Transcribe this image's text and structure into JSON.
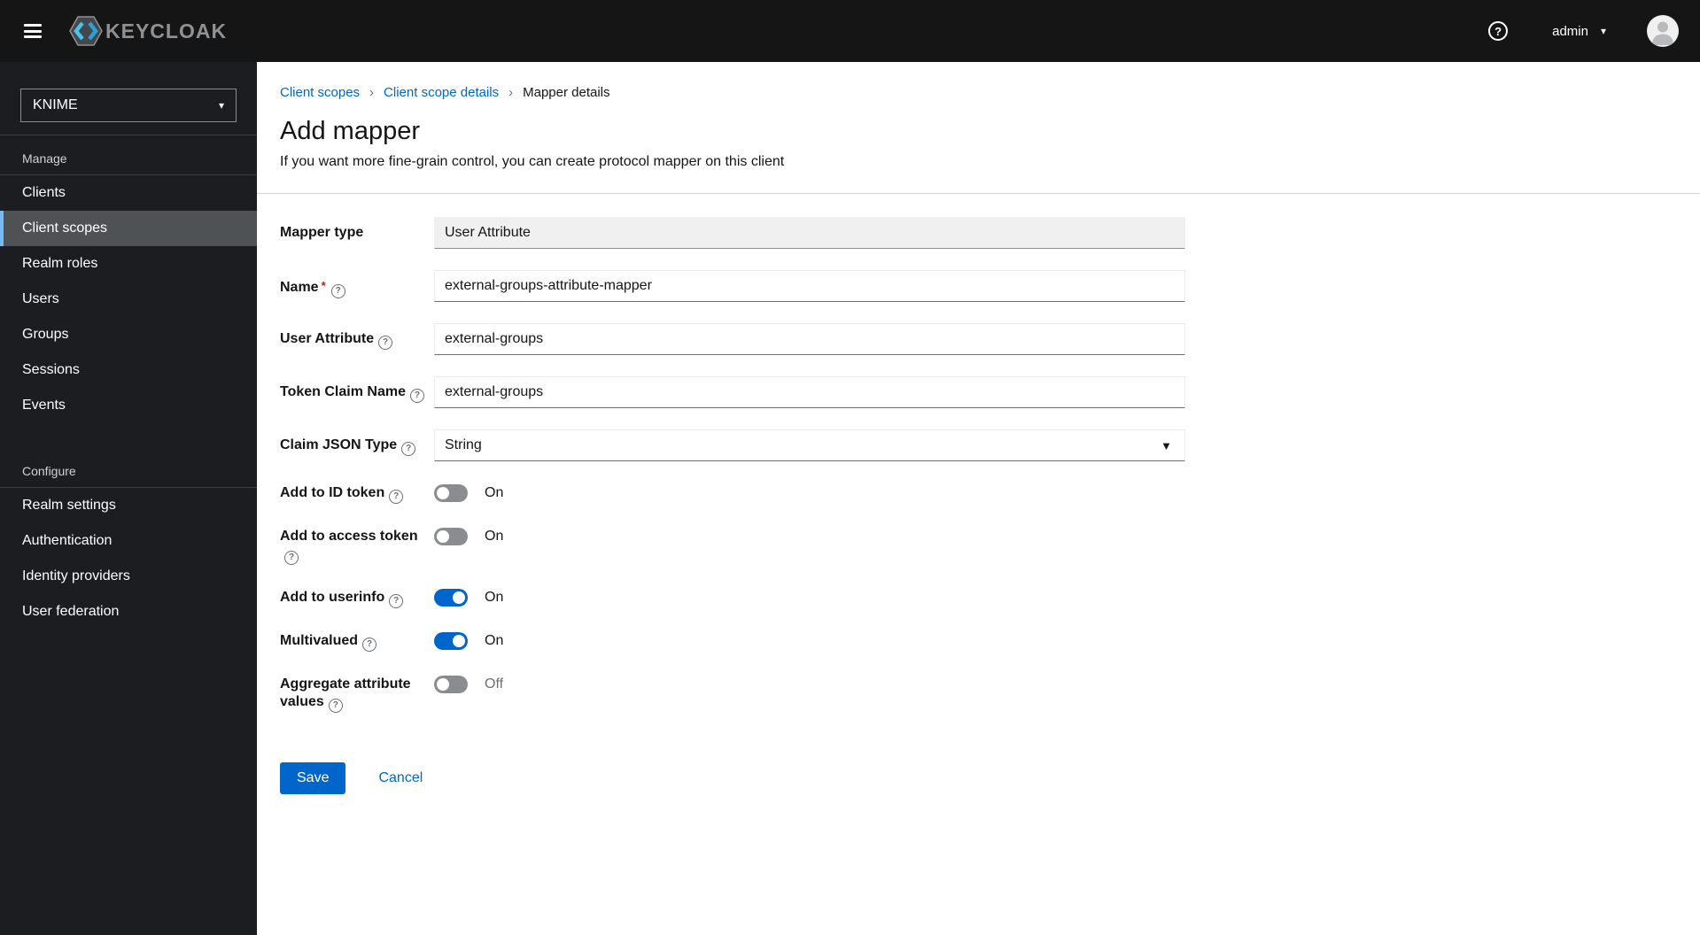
{
  "masthead": {
    "brand": "KEYCLOAK",
    "user": "admin"
  },
  "sidebar": {
    "realm": "KNIME",
    "sections": [
      {
        "title": "Manage",
        "items": [
          "Clients",
          "Client scopes",
          "Realm roles",
          "Users",
          "Groups",
          "Sessions",
          "Events"
        ],
        "selected": "Client scopes"
      },
      {
        "title": "Configure",
        "items": [
          "Realm settings",
          "Authentication",
          "Identity providers",
          "User federation"
        ]
      }
    ]
  },
  "breadcrumb": {
    "items": [
      "Client scopes",
      "Client scope details",
      "Mapper details"
    ]
  },
  "page": {
    "title": "Add mapper",
    "subtitle": "If you want more fine-grain control, you can create protocol mapper on this client"
  },
  "form": {
    "fields": [
      {
        "label": "Mapper type",
        "value": "User Attribute",
        "disabled": true
      },
      {
        "label": "Name",
        "value": "external-groups-attribute-mapper",
        "required": "*"
      },
      {
        "label": "User Attribute",
        "value": "external-groups"
      },
      {
        "label": "Token Claim Name",
        "value": "external-groups"
      },
      {
        "label": "Claim JSON Type",
        "value": "String",
        "type": "select"
      }
    ],
    "help_glyph": "?",
    "toggles": [
      {
        "label": "Add to ID token",
        "state": "On",
        "on": false
      },
      {
        "label": "Add to access token",
        "state": "On",
        "on": false
      },
      {
        "label": "Add to userinfo",
        "state": "On",
        "on": true
      },
      {
        "label": "Multivalued",
        "state": "On",
        "on": true
      },
      {
        "label": "Aggregate attribute values",
        "state": "Off",
        "on": false
      }
    ],
    "actions": {
      "save": "Save",
      "cancel": "Cancel"
    }
  },
  "colors": {
    "primary_blue": "#0066cc",
    "link_blue": "#0066cc",
    "selected_indicator": "#73bcf7",
    "required_red": "#c9190b",
    "masthead_bg": "#151515",
    "sidebar_bg": "#1b1d21",
    "sidebar_selected_bg": "#4f5255",
    "brand_cyan": "#3bb3e0",
    "toggle_off": "#8a8d90"
  }
}
